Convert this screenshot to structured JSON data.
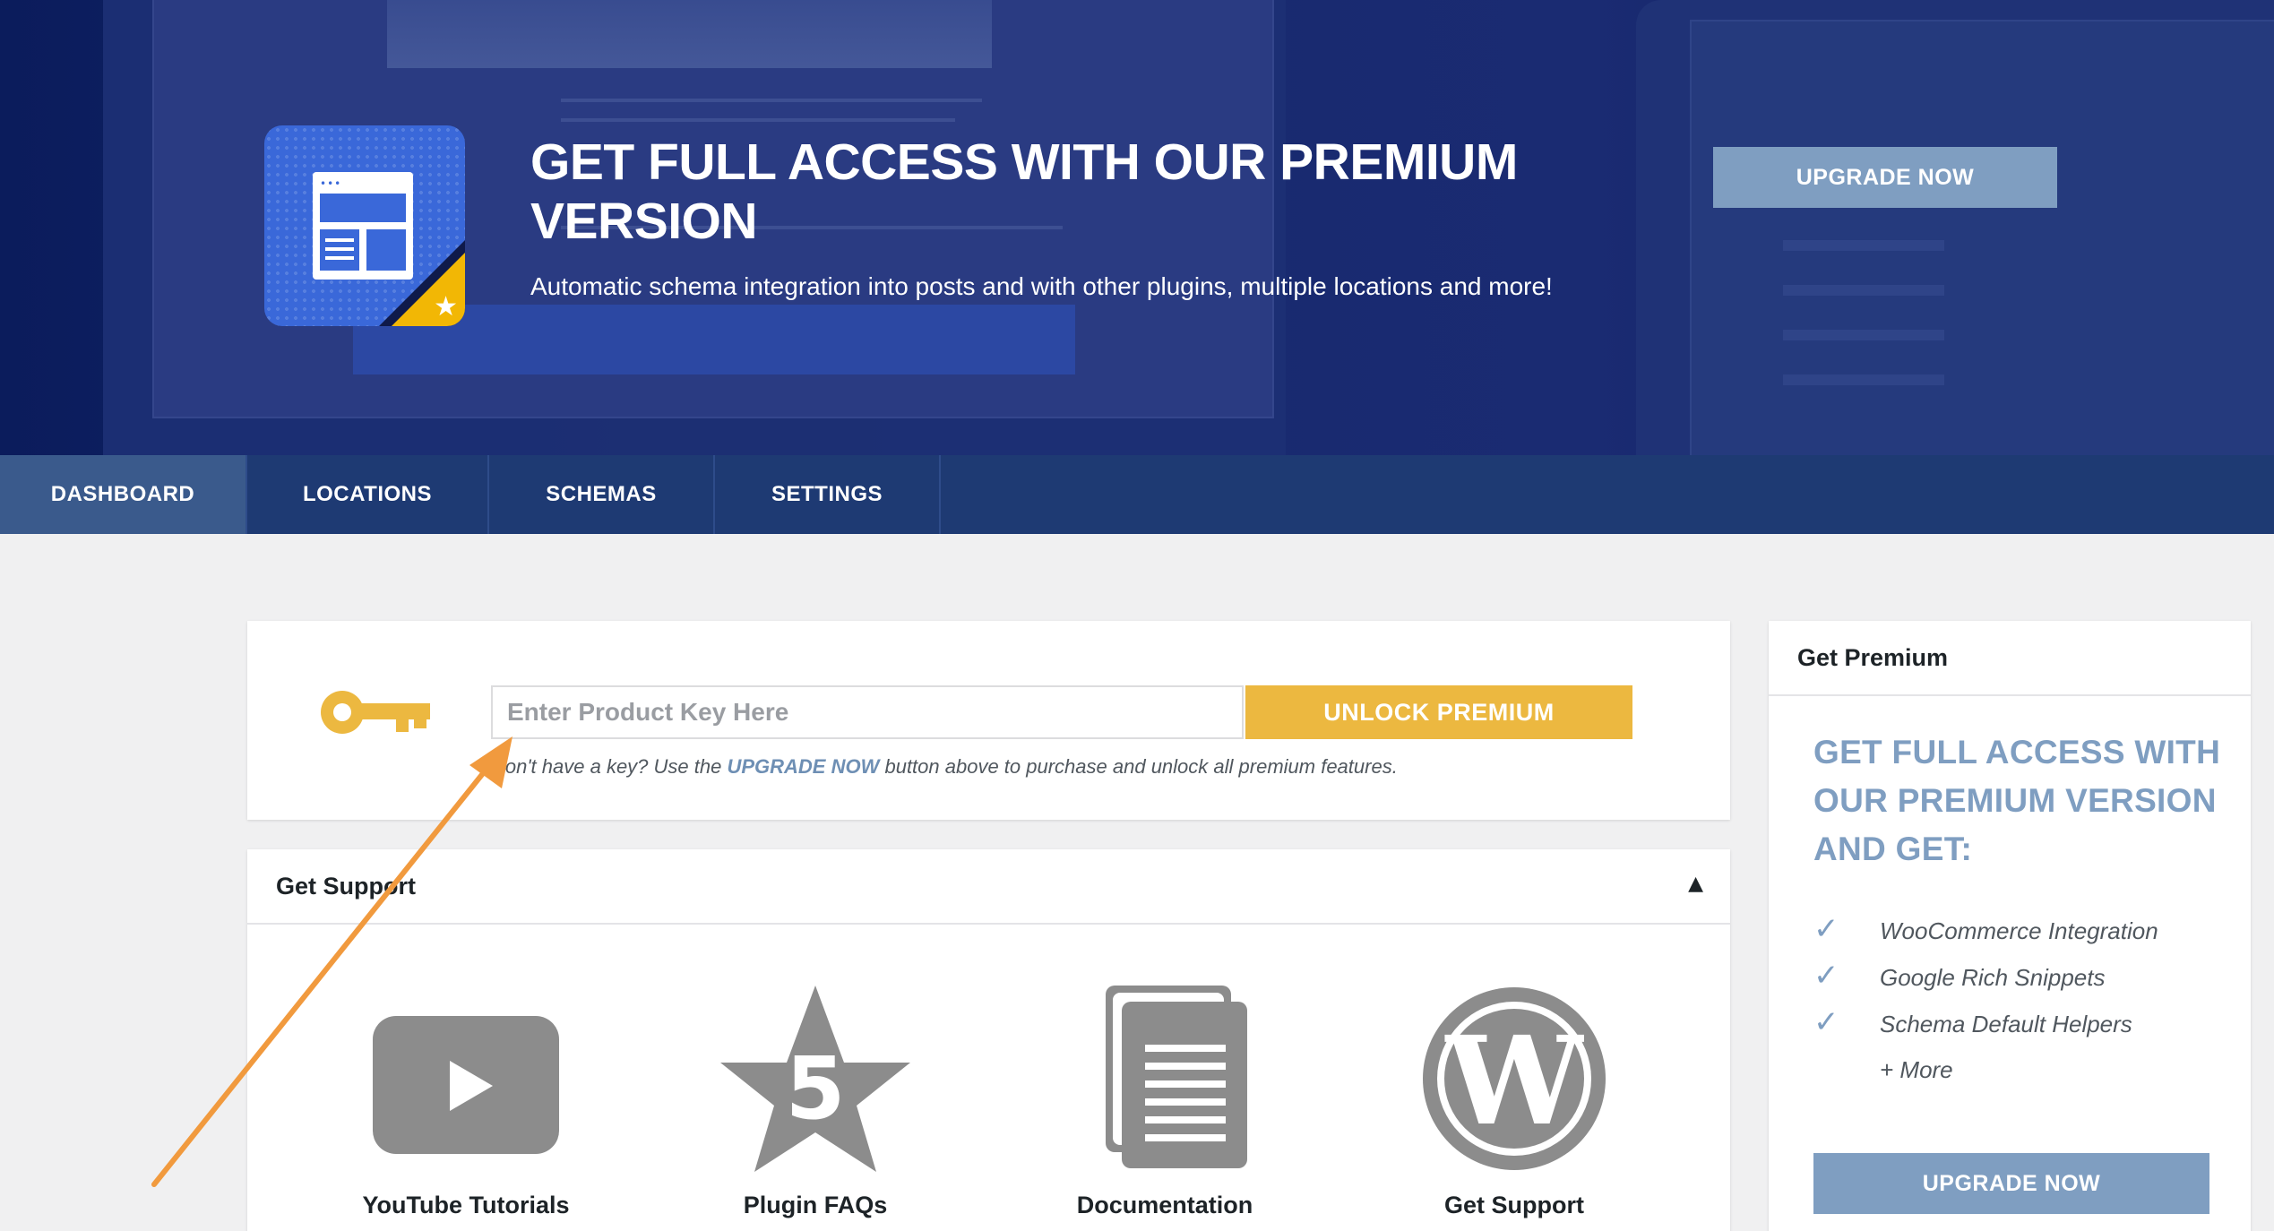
{
  "hero": {
    "title": "GET FULL ACCESS WITH OUR PREMIUM VERSION",
    "subtitle": "Automatic schema integration into posts and with other plugins, multiple locations and more!",
    "upgrade_label": "UPGRADE NOW",
    "icon": "schema-plugin-icon",
    "badge_icon": "star-icon"
  },
  "nav": {
    "tabs": [
      {
        "label": "DASHBOARD",
        "active": true
      },
      {
        "label": "LOCATIONS",
        "active": false
      },
      {
        "label": "SCHEMAS",
        "active": false
      },
      {
        "label": "SETTINGS",
        "active": false
      }
    ]
  },
  "license": {
    "icon": "key-icon",
    "placeholder": "Enter Product Key Here",
    "value": "",
    "unlock_label": "UNLOCK PREMIUM",
    "help_prefix": "Don't have a key? Use the ",
    "help_link": "UPGRADE NOW",
    "help_suffix": " button above to purchase and unlock all premium features."
  },
  "support": {
    "title": "Get Support",
    "toggle": "▲",
    "items": [
      {
        "label": "YouTube Tutorials",
        "icon": "youtube-icon"
      },
      {
        "label": "Plugin FAQs",
        "icon": "star-five-icon",
        "badge": "5"
      },
      {
        "label": "Documentation",
        "icon": "document-icon"
      },
      {
        "label": "Get Support",
        "icon": "wordpress-icon"
      }
    ]
  },
  "sidebar": {
    "header": "Get Premium",
    "title": "GET FULL ACCESS WITH OUR PREMIUM VERSION AND GET:",
    "features": [
      "WooCommerce Integration",
      "Google Rich Snippets",
      "Schema Default Helpers"
    ],
    "more": "+ More",
    "upgrade_label": "UPGRADE NOW"
  },
  "colors": {
    "hero_bg": "#17296e",
    "nav_bg": "#1e3a73",
    "nav_active": "#3a5a8c",
    "accent_blue": "#7f9ec1",
    "accent_yellow": "#ecb840",
    "arrow": "#f19a3e"
  }
}
